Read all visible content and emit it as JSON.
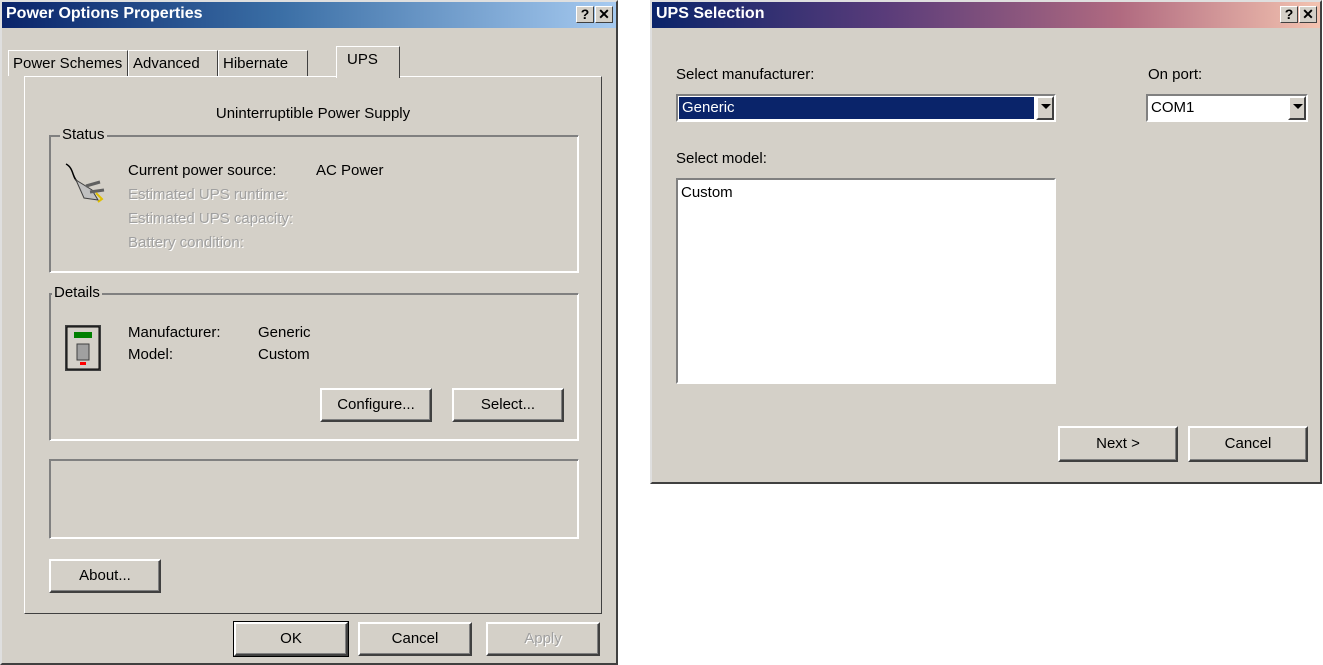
{
  "power_window": {
    "title": "Power Options Properties",
    "help_label": "?",
    "close_label": "✕",
    "tabs": [
      {
        "label": "Power Schemes"
      },
      {
        "label": "Advanced"
      },
      {
        "label": "Hibernate"
      },
      {
        "label": "UPS"
      }
    ],
    "header": "Uninterruptible Power Supply",
    "status": {
      "legend": "Status",
      "rows": [
        {
          "label": "Current power source:",
          "value": "AC Power"
        },
        {
          "label": "Estimated UPS runtime:",
          "value": ""
        },
        {
          "label": "Estimated UPS capacity:",
          "value": ""
        },
        {
          "label": "Battery condition:",
          "value": ""
        }
      ]
    },
    "details": {
      "legend": "Details",
      "manufacturer_label": "Manufacturer:",
      "manufacturer_value": "Generic",
      "model_label": "Model:",
      "model_value": "Custom",
      "configure_label": "Configure...",
      "select_label": "Select..."
    },
    "about_label": "About...",
    "ok_label": "OK",
    "cancel_label": "Cancel",
    "apply_label": "Apply"
  },
  "ups_window": {
    "title": "UPS Selection",
    "help_label": "?",
    "close_label": "✕",
    "manufacturer_label": "Select manufacturer:",
    "manufacturer_value": "Generic",
    "port_label": "On port:",
    "port_value": "COM1",
    "model_label": "Select model:",
    "model_items": [
      "Custom"
    ],
    "next_label": "Next >",
    "cancel_label": "Cancel"
  }
}
